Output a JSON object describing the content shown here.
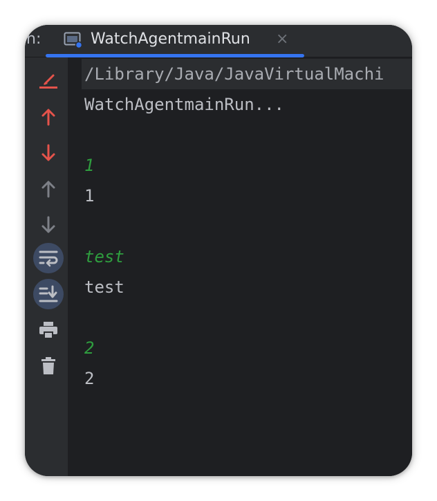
{
  "tabbar": {
    "prefix": "n:",
    "tab": {
      "label": "WatchAgentmainRun",
      "icon": "console-window-icon",
      "close_glyph": "×"
    },
    "accent": "#3574f0"
  },
  "toolbar": {
    "tools": [
      {
        "name": "clear-all-icon",
        "color": "#e5534b"
      },
      {
        "name": "up-stack-trace-icon",
        "color": "#e5534b"
      },
      {
        "name": "down-stack-trace-icon",
        "color": "#e5534b"
      },
      {
        "name": "scroll-up-icon",
        "color": "#7d8087"
      },
      {
        "name": "scroll-down-icon",
        "color": "#7d8087"
      },
      {
        "name": "soft-wrap-icon",
        "color": "#bcbec4",
        "active": true
      },
      {
        "name": "scroll-to-end-icon",
        "color": "#bcbec4",
        "active": true
      },
      {
        "name": "print-icon",
        "color": "#bcbec4"
      },
      {
        "name": "trash-icon",
        "color": "#bcbec4"
      }
    ]
  },
  "console": {
    "lines": [
      {
        "kind": "cmd",
        "text": "/Library/Java/JavaVirtualMachi"
      },
      {
        "kind": "out",
        "text": "WatchAgentmainRun..."
      },
      {
        "kind": "in",
        "text": "1"
      },
      {
        "kind": "out",
        "text": "1"
      },
      {
        "kind": "in",
        "text": "test"
      },
      {
        "kind": "out",
        "text": "test"
      },
      {
        "kind": "in",
        "text": "2"
      },
      {
        "kind": "out",
        "text": "2"
      }
    ],
    "colors": {
      "input": "#2f9e3f",
      "output": "#bcbec4",
      "command": "#a9acb2"
    }
  }
}
